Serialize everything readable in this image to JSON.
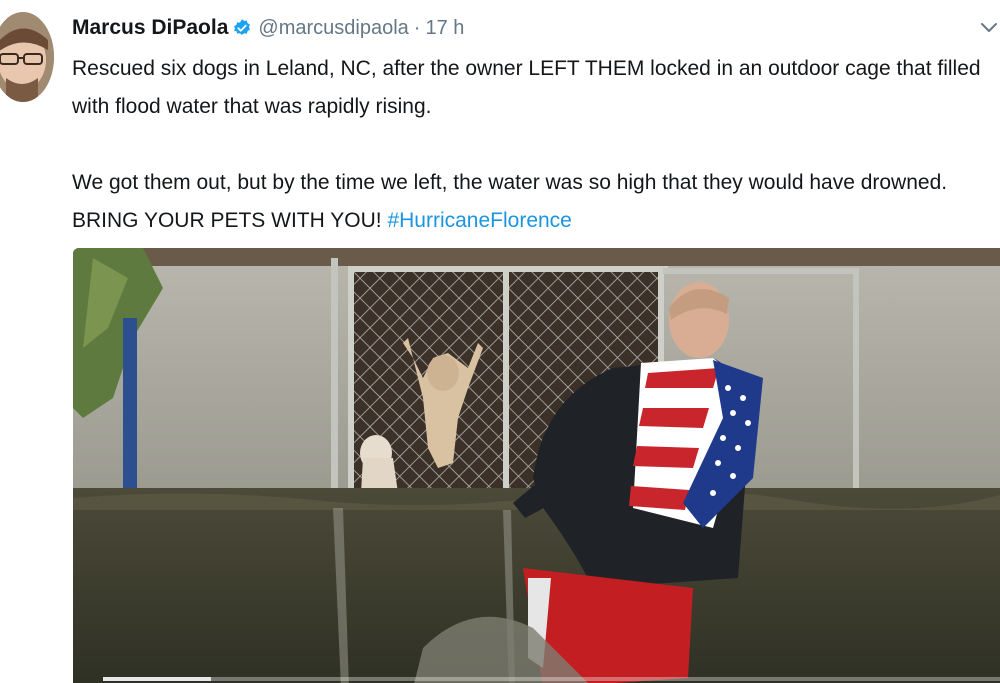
{
  "tweet": {
    "display_name": "Marcus DiPaola",
    "handle": "@marcusdipaola",
    "separator": "·",
    "time": "17 h",
    "paragraph1": "Rescued six dogs in Leland, NC, after the owner LEFT THEM locked in an outdoor cage that filled with flood water that was rapidly rising.",
    "paragraph2_text": "We got them out, but by the time we left, the water was so high that they would have drowned. BRING YOUR PETS WITH YOU! ",
    "hashtag": "#HurricaneFlorence"
  },
  "icons": {
    "verified": "verified-badge-icon",
    "caret": "chevron-down-icon"
  },
  "colors": {
    "link": "#1b95e0",
    "secondary_text": "#657786",
    "verified_blue": "#1da1f2"
  },
  "media": {
    "type": "video",
    "progress": 0.12
  }
}
